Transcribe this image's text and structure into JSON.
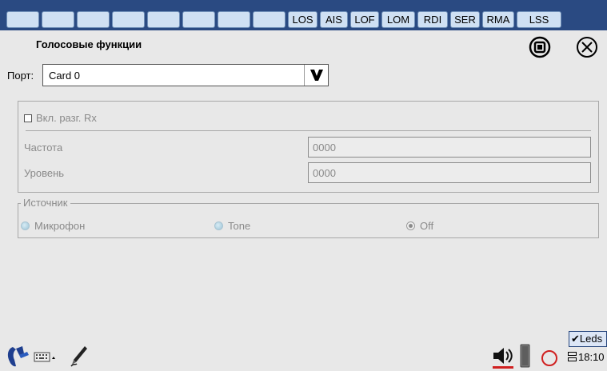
{
  "top_bar": {
    "leds": [
      {
        "label": ""
      },
      {
        "label": ""
      },
      {
        "label": ""
      },
      {
        "label": ""
      },
      {
        "label": ""
      },
      {
        "label": ""
      },
      {
        "label": ""
      },
      {
        "label": ""
      },
      {
        "label": "LOS"
      },
      {
        "label": "AIS"
      },
      {
        "label": "LOF"
      },
      {
        "label": "LOM"
      },
      {
        "label": "RDI"
      },
      {
        "label": "SER"
      },
      {
        "label": "RMA"
      },
      {
        "label": "LSS"
      }
    ]
  },
  "header": {
    "title": "Голосовые функции",
    "stop_icon": "stop-icon",
    "close_icon": "close-icon"
  },
  "port": {
    "label": "Порт:",
    "value": "Card 0",
    "dropdown_icon": "chevron-down-icon"
  },
  "rx_group": {
    "checkbox_label": "Вкл. разг. Rx",
    "checked": false,
    "frequency_label": "Частота",
    "frequency_value": "0000",
    "level_label": "Уровень",
    "level_value": "0000"
  },
  "source_group": {
    "legend": "Источник",
    "options": [
      {
        "label": "Микрофон",
        "selected": false
      },
      {
        "label": "Tone",
        "selected": false
      },
      {
        "label": "Off",
        "selected": true
      }
    ]
  },
  "status_bar": {
    "leds_toggle": "✔Leds",
    "time": "18:10",
    "icons": [
      "logo-icon",
      "keyboard-icon",
      "pen-icon",
      "speaker-icon",
      "battery-icon",
      "record-icon",
      "network-icon"
    ]
  },
  "colors": {
    "top_bar": "#2a4a82",
    "led_fill": "#cfe0f3",
    "background": "#e8e8e8",
    "disabled_text": "#8a8a8a",
    "record_red": "#d02020",
    "speaker_underline": "#d02020"
  }
}
